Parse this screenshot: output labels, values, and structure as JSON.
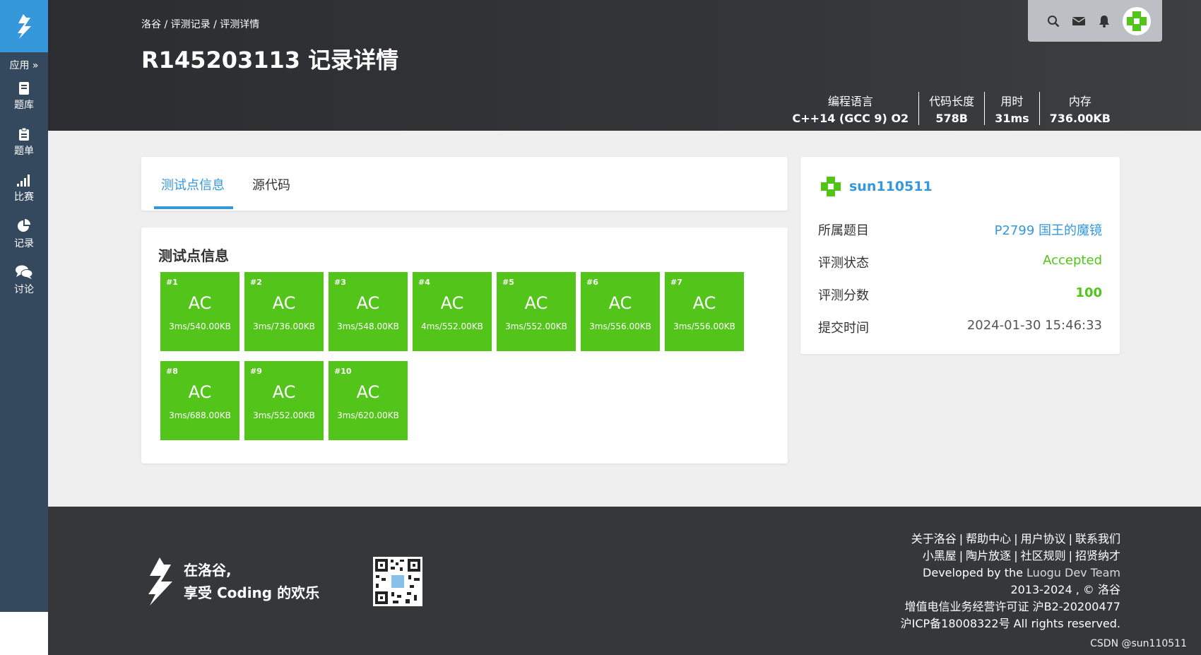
{
  "sidebar": {
    "apps_label": "应用 »",
    "items": [
      {
        "label": "题库",
        "icon": "book-icon"
      },
      {
        "label": "题单",
        "icon": "clipboard-icon"
      },
      {
        "label": "比赛",
        "icon": "bar-chart-icon"
      },
      {
        "label": "记录",
        "icon": "pie-chart-icon"
      },
      {
        "label": "讨论",
        "icon": "comments-icon"
      }
    ]
  },
  "header": {
    "breadcrumb": "洛谷 / 评测记录 / 评测详情",
    "title": "R145203113 记录详情",
    "stats": [
      {
        "label": "编程语言",
        "value": "C++14 (GCC 9) O2"
      },
      {
        "label": "代码长度",
        "value": "578B"
      },
      {
        "label": "用时",
        "value": "31ms"
      },
      {
        "label": "内存",
        "value": "736.00KB"
      }
    ]
  },
  "tabs": [
    {
      "label": "测试点信息",
      "active": true
    },
    {
      "label": "源代码",
      "active": false
    }
  ],
  "tests": {
    "title": "测试点信息",
    "items": [
      {
        "num": "#1",
        "status": "AC",
        "detail": "3ms/540.00KB"
      },
      {
        "num": "#2",
        "status": "AC",
        "detail": "3ms/736.00KB"
      },
      {
        "num": "#3",
        "status": "AC",
        "detail": "3ms/548.00KB"
      },
      {
        "num": "#4",
        "status": "AC",
        "detail": "4ms/552.00KB"
      },
      {
        "num": "#5",
        "status": "AC",
        "detail": "3ms/552.00KB"
      },
      {
        "num": "#6",
        "status": "AC",
        "detail": "3ms/556.00KB"
      },
      {
        "num": "#7",
        "status": "AC",
        "detail": "3ms/556.00KB"
      },
      {
        "num": "#8",
        "status": "AC",
        "detail": "3ms/688.00KB"
      },
      {
        "num": "#9",
        "status": "AC",
        "detail": "3ms/552.00KB"
      },
      {
        "num": "#10",
        "status": "AC",
        "detail": "3ms/620.00KB"
      }
    ]
  },
  "info": {
    "username": "sun110511",
    "problem_label": "所属题目",
    "problem_value": "P2799 国王的魔镜",
    "status_label": "评测状态",
    "status_value": "Accepted",
    "score_label": "评测分数",
    "score_value": "100",
    "time_label": "提交时间",
    "time_value": "2024-01-30 15:46:33"
  },
  "footer": {
    "slogan_line1": "在洛谷,",
    "slogan_line2": "享受 Coding 的欢乐",
    "links_row1": [
      "关于洛谷",
      "帮助中心",
      "用户协议",
      "联系我们"
    ],
    "links_row2": [
      "小黑屋",
      "陶片放逐",
      "社区规则",
      "招贤纳才"
    ],
    "developed_by": "Developed by the",
    "dev_team": "Luogu Dev Team",
    "copyright": "2013-2024 , © 洛谷",
    "license": "增值电信业务经营许可证 沪B2-20200477",
    "icp": "沪ICP备18008322号 All rights reserved."
  },
  "watermark": "CSDN @sun110511",
  "colors": {
    "accent": "#3498db",
    "sidebar": "#34495e",
    "ac_green": "#52c41a"
  }
}
